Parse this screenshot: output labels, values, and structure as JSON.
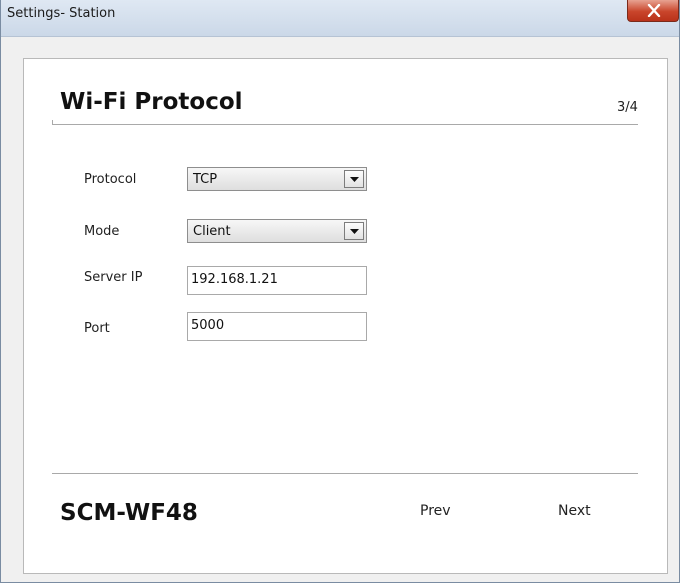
{
  "window": {
    "title": "Settings- Station"
  },
  "page": {
    "heading": "Wi-Fi Protocol",
    "step": "3/4"
  },
  "form": {
    "protocol": {
      "label": "Protocol",
      "value": "TCP"
    },
    "mode": {
      "label": "Mode",
      "value": "Client"
    },
    "server_ip": {
      "label": "Server IP",
      "value": "192.168.1.21"
    },
    "port": {
      "label": "Port",
      "value": "5000"
    }
  },
  "footer": {
    "model": "SCM-WF48",
    "prev_label": "Prev",
    "next_label": "Next"
  },
  "icons": {
    "close": "close-icon",
    "dropdown": "triangle-down-icon"
  }
}
